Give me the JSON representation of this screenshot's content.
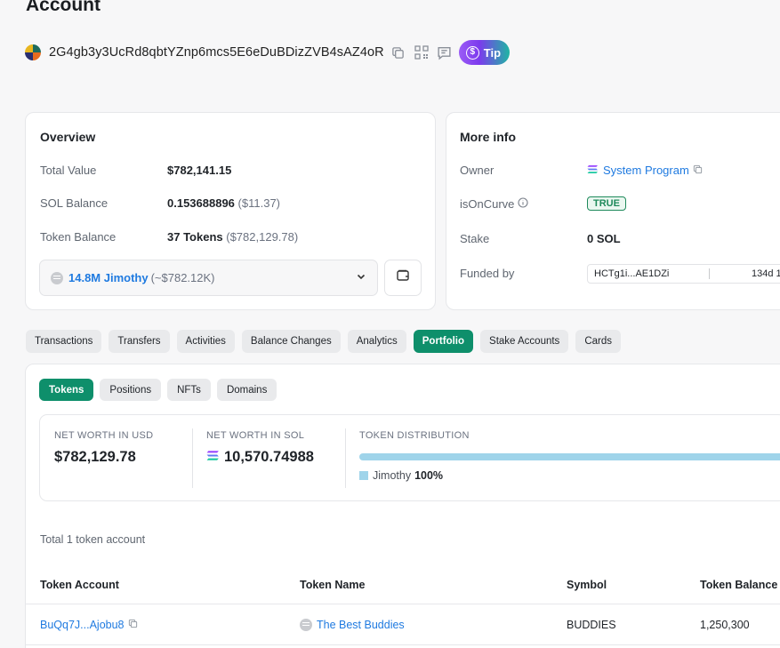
{
  "header": {
    "title": "Account",
    "address": "2G4gb3y3UcRd8qbtYZnp6mcs5E6eDuBDizZVB4sAZ4oR",
    "tip_label": "Tip"
  },
  "overview": {
    "title": "Overview",
    "rows": [
      {
        "label": "Total Value",
        "value": "$782,141.15",
        "sub": ""
      },
      {
        "label": "SOL Balance",
        "value": "0.153688896",
        "sub": "($11.37)"
      },
      {
        "label": "Token Balance",
        "value": "37 Tokens",
        "sub": "($782,129.78)"
      }
    ],
    "token_select": {
      "amount": "14.8M Jimothy",
      "usd": "(~$782.12K)"
    }
  },
  "more_info": {
    "title": "More info",
    "owner_label": "Owner",
    "owner_value": "System Program",
    "oncurve_label": "isOnCurve",
    "oncurve_value": "TRUE",
    "stake_label": "Stake",
    "stake_value": "0 SOL",
    "funded_label": "Funded by",
    "funded_addr": "HCTg1i...AE1DZi",
    "funded_age": "134d 1"
  },
  "tabs": [
    "Transactions",
    "Transfers",
    "Activities",
    "Balance Changes",
    "Analytics",
    "Portfolio",
    "Stake Accounts",
    "Cards"
  ],
  "active_tab": "Portfolio",
  "subtabs": [
    "Tokens",
    "Positions",
    "NFTs",
    "Domains"
  ],
  "active_subtab": "Tokens",
  "net_worth": {
    "usd_label": "NET WORTH IN USD",
    "usd_value": "$782,129.78",
    "sol_label": "NET WORTH IN SOL",
    "sol_value": "10,570.74988",
    "dist_label": "TOKEN DISTRIBUTION",
    "dist_name": "Jimothy",
    "dist_pct": "100%",
    "dist_fraction": 1.0
  },
  "token_table": {
    "total_label": "Total 1 token account",
    "headers": [
      "Token Account",
      "Token Name",
      "Symbol",
      "Token Balance"
    ],
    "rows": [
      {
        "account": "BuQq7J...Ajobu8",
        "name": "The Best Buddies",
        "symbol": "BUDDIES",
        "balance": "1,250,300"
      }
    ]
  },
  "colors": {
    "accent": "#0e8f6b",
    "link": "#1f7ae0",
    "dist_bar": "#9fd4ea"
  }
}
